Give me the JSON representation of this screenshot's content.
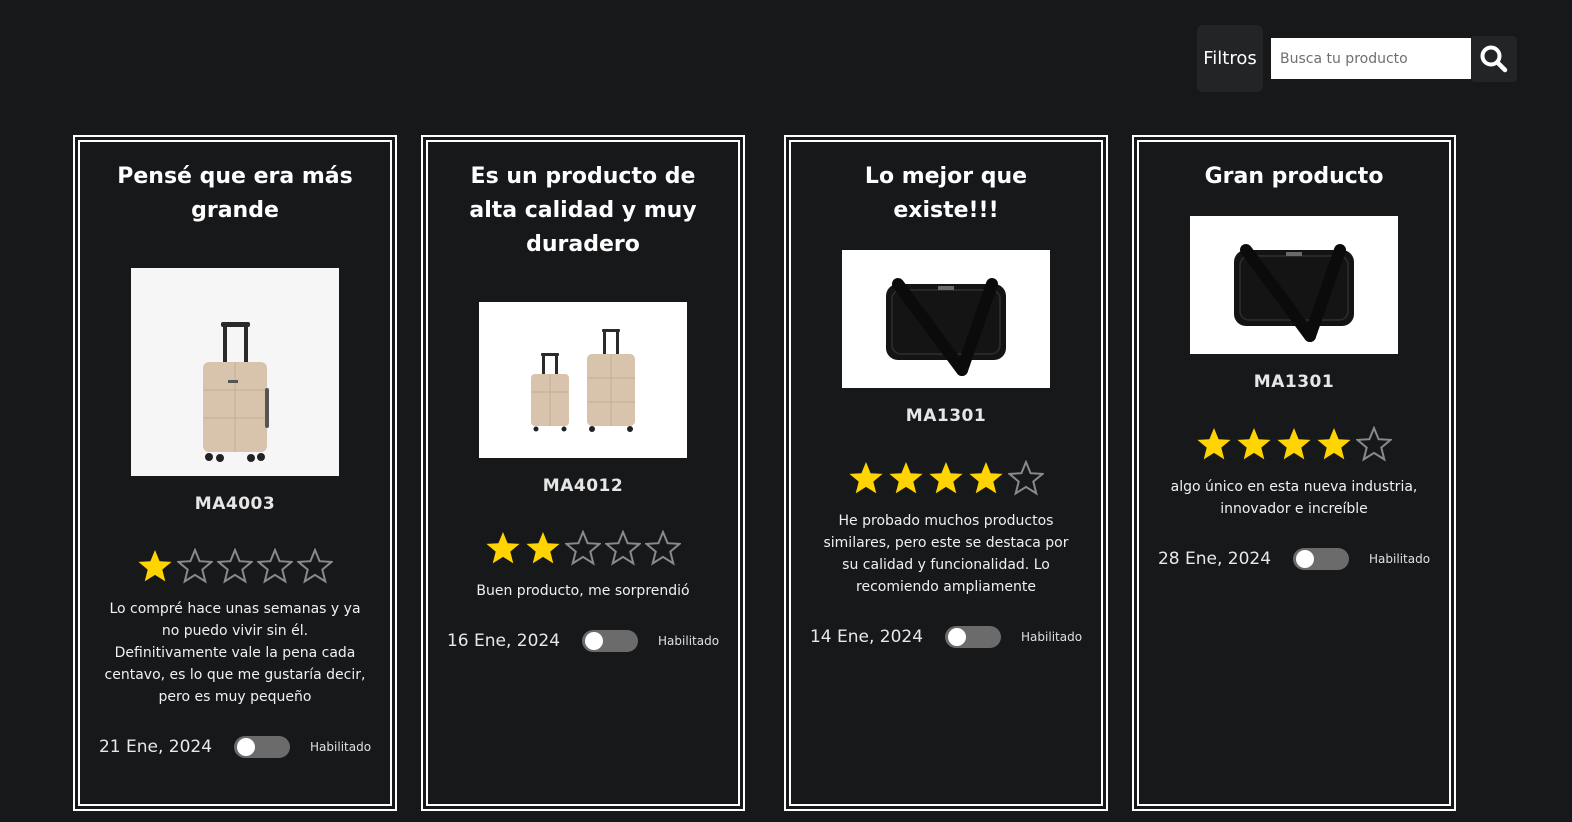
{
  "toolbar": {
    "filters_label": "Filtros",
    "search_placeholder": "Busca tu producto",
    "search_icon": "search-icon"
  },
  "colors": {
    "background": "#17181a",
    "star_filled": "#ffd400",
    "star_empty": "#8a8a8a",
    "toggle_track": "#6b6b6b"
  },
  "reviews": [
    {
      "title": "Pensé que era más grande",
      "image": "single-beige-suitcase",
      "product_code": "MA4003",
      "rating": 1,
      "max_rating": 5,
      "text": "Lo compré hace unas semanas y ya no puedo vivir sin él. Definitivamente vale la pena cada centavo, es lo que me gustaría decir, pero es muy pequeño",
      "date": "21 Ene, 2024",
      "enabled": false,
      "status_label": "Habilitado"
    },
    {
      "title": "Es un producto de alta calidad y muy duradero",
      "image": "two-beige-suitcases",
      "product_code": "MA4012",
      "rating": 2,
      "max_rating": 5,
      "text": "Buen producto, me sorprendió",
      "date": "16 Ene, 2024",
      "enabled": false,
      "status_label": "Habilitado"
    },
    {
      "title": "Lo mejor que existe!!!",
      "image": "black-laptop-bag",
      "product_code": "MA1301",
      "rating": 4,
      "max_rating": 5,
      "text": "He probado muchos productos similares, pero este se destaca por su calidad y funcionalidad. Lo recomiendo ampliamente",
      "date": "14 Ene, 2024",
      "enabled": false,
      "status_label": "Habilitado"
    },
    {
      "title": "Gran producto",
      "image": "black-laptop-bag",
      "product_code": "MA1301",
      "rating": 4,
      "max_rating": 5,
      "text": "algo único en esta nueva industria, innovador e increíble",
      "date": "28 Ene, 2024",
      "enabled": false,
      "status_label": "Habilitado"
    }
  ]
}
